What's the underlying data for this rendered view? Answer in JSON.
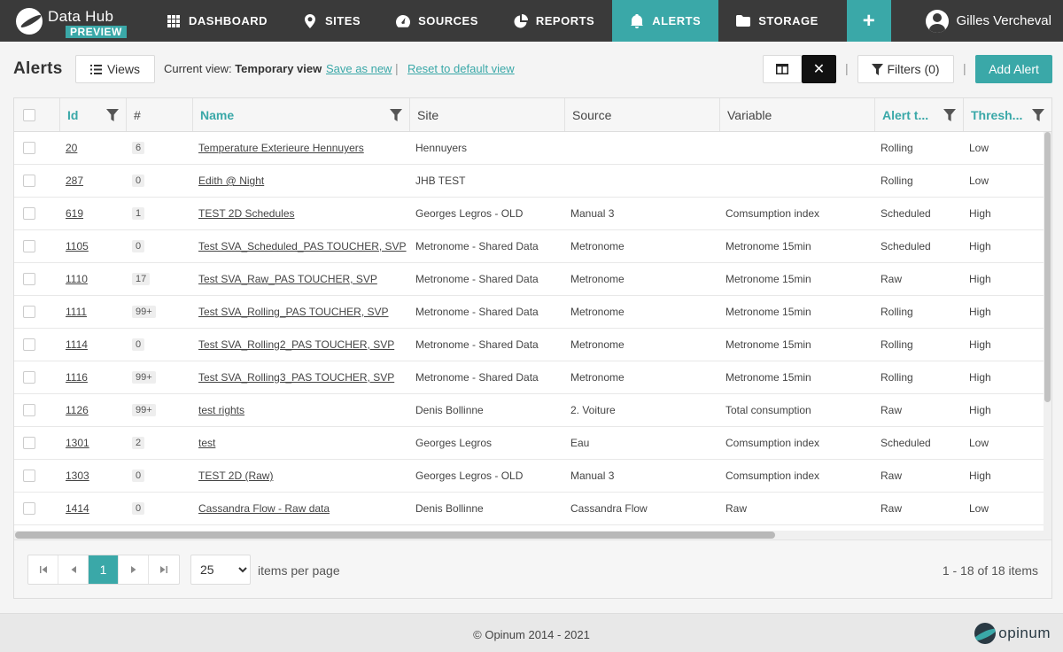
{
  "brand": {
    "name": "Data Hub",
    "badge": "PREVIEW"
  },
  "nav": {
    "items": [
      {
        "label": "DASHBOARD",
        "icon": "grid-icon"
      },
      {
        "label": "SITES",
        "icon": "map-pin-icon"
      },
      {
        "label": "SOURCES",
        "icon": "gauge-icon"
      },
      {
        "label": "REPORTS",
        "icon": "pie-chart-icon"
      },
      {
        "label": "ALERTS",
        "icon": "bell-icon",
        "active": true
      },
      {
        "label": "STORAGE",
        "icon": "folder-icon"
      }
    ],
    "plus": "+",
    "user": "Gilles Vercheval"
  },
  "toolbar": {
    "title": "Alerts",
    "views_label": "Views",
    "current_view_prefix": "Current view:",
    "current_view_name": "Temporary view",
    "save_as_new": "Save as new",
    "separator": "|",
    "reset": "Reset to default view",
    "close": "✕",
    "filters": "Filters (0)",
    "add_alert": "Add Alert"
  },
  "grid": {
    "columns": [
      {
        "label": "Id"
      },
      {
        "label": "#"
      },
      {
        "label": "Name"
      },
      {
        "label": "Site"
      },
      {
        "label": "Source"
      },
      {
        "label": "Variable"
      },
      {
        "label": "Alert t..."
      },
      {
        "label": "Thresh..."
      }
    ],
    "rows": [
      {
        "id": "20",
        "count": "6",
        "name": "Temperature Exterieure Hennuyers",
        "site": "Hennuyers",
        "source": "",
        "variable": "",
        "alert_type": "Rolling",
        "threshold": "Low"
      },
      {
        "id": "287",
        "count": "0",
        "name": "Edith @ Night",
        "site": "JHB TEST",
        "source": "",
        "variable": "",
        "alert_type": "Rolling",
        "threshold": "Low"
      },
      {
        "id": "619",
        "count": "1",
        "name": "TEST 2D Schedules",
        "site": "Georges Legros - OLD",
        "source": "Manual 3",
        "variable": "Comsumption index",
        "alert_type": "Scheduled",
        "threshold": "High"
      },
      {
        "id": "1105",
        "count": "0",
        "name": "Test SVA_Scheduled_PAS TOUCHER, SVP",
        "site": "Metronome - Shared Data",
        "source": "Metronome",
        "variable": "Metronome 15min",
        "alert_type": "Scheduled",
        "threshold": "High"
      },
      {
        "id": "1110",
        "count": "17",
        "name": "Test SVA_Raw_PAS TOUCHER, SVP",
        "site": "Metronome - Shared Data",
        "source": "Metronome",
        "variable": "Metronome 15min",
        "alert_type": "Raw",
        "threshold": "High"
      },
      {
        "id": "1111",
        "count": "99+",
        "name": "Test SVA_Rolling_PAS TOUCHER, SVP",
        "site": "Metronome - Shared Data",
        "source": "Metronome",
        "variable": "Metronome 15min",
        "alert_type": "Rolling",
        "threshold": "High"
      },
      {
        "id": "1114",
        "count": "0",
        "name": "Test SVA_Rolling2_PAS TOUCHER, SVP",
        "site": "Metronome - Shared Data",
        "source": "Metronome",
        "variable": "Metronome 15min",
        "alert_type": "Rolling",
        "threshold": "High"
      },
      {
        "id": "1116",
        "count": "99+",
        "name": "Test SVA_Rolling3_PAS TOUCHER, SVP",
        "site": "Metronome - Shared Data",
        "source": "Metronome",
        "variable": "Metronome 15min",
        "alert_type": "Rolling",
        "threshold": "High"
      },
      {
        "id": "1126",
        "count": "99+",
        "name": "test rights",
        "site": "Denis Bollinne",
        "source": "2. Voiture",
        "variable": "Total consumption",
        "alert_type": "Raw",
        "threshold": "High"
      },
      {
        "id": "1301",
        "count": "2",
        "name": "test",
        "site": "Georges Legros",
        "source": "Eau",
        "variable": "Comsumption index",
        "alert_type": "Scheduled",
        "threshold": "Low"
      },
      {
        "id": "1303",
        "count": "0",
        "name": "TEST 2D (Raw)",
        "site": "Georges Legros - OLD",
        "source": "Manual 3",
        "variable": "Comsumption index",
        "alert_type": "Raw",
        "threshold": "High"
      },
      {
        "id": "1414",
        "count": "0",
        "name": "Cassandra Flow - Raw data",
        "site": "Denis Bollinne",
        "source": "Cassandra Flow",
        "variable": "Raw",
        "alert_type": "Raw",
        "threshold": "Low"
      }
    ]
  },
  "pager": {
    "current_page": "1",
    "page_size": "25",
    "page_size_label": "items per page",
    "info": "1 - 18 of 18 items"
  },
  "footer": {
    "copyright": "© Opinum 2014 - 2021",
    "logo_text": "opinum"
  },
  "colors": {
    "accent": "#3aa8a8",
    "navbar": "#3a3a3a"
  }
}
